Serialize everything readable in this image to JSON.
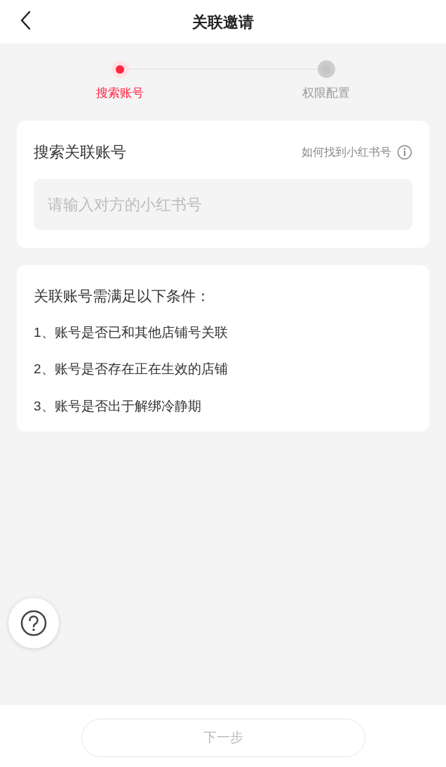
{
  "header": {
    "title": "关联邀请"
  },
  "steps": [
    {
      "label": "搜索账号",
      "selected": true
    },
    {
      "label": "权限配置",
      "selected": false
    }
  ],
  "search_card": {
    "title": "搜索关联账号",
    "help_link": "如何找到小红书号",
    "input": {
      "placeholder": "请输入对方的小红书号"
    }
  },
  "conditions_card": {
    "title": "关联账号需满足以下条件：",
    "items": [
      "1、账号是否已和其他店铺号关联",
      "2、账号是否存在正在生效的店铺",
      "3、账号是否出于解绑冷静期"
    ]
  },
  "next_button": {
    "label": "下一步",
    "disabled": true
  }
}
